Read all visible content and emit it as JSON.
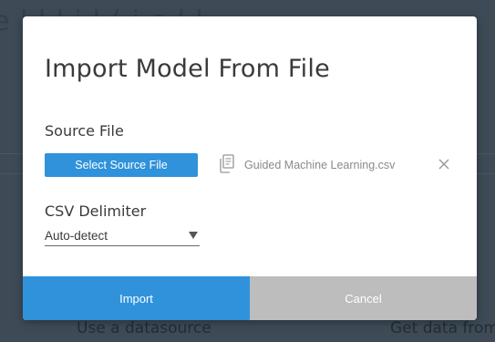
{
  "background": {
    "top_text": "e  l                 l  l i l    ( i  e     l          l",
    "bottom_left_text": "Use a datasource",
    "bottom_right_text": "Get data from"
  },
  "dialog": {
    "title": "Import Model From File",
    "source_file": {
      "label": "Source File",
      "select_button_label": "Select Source File",
      "file_icon": "file-document-icon",
      "selected_file_name": "Guided Machine Learning.csv",
      "remove_icon": "close-icon"
    },
    "csv_delimiter": {
      "label": "CSV Delimiter",
      "selected_value": "Auto-detect",
      "caret_icon": "caret-down-icon"
    },
    "buttons": {
      "import_label": "Import",
      "cancel_label": "Cancel"
    }
  },
  "colors": {
    "primary": "#2f92db",
    "cancel": "#bdbdbd",
    "overlay": "#3e4b57"
  }
}
